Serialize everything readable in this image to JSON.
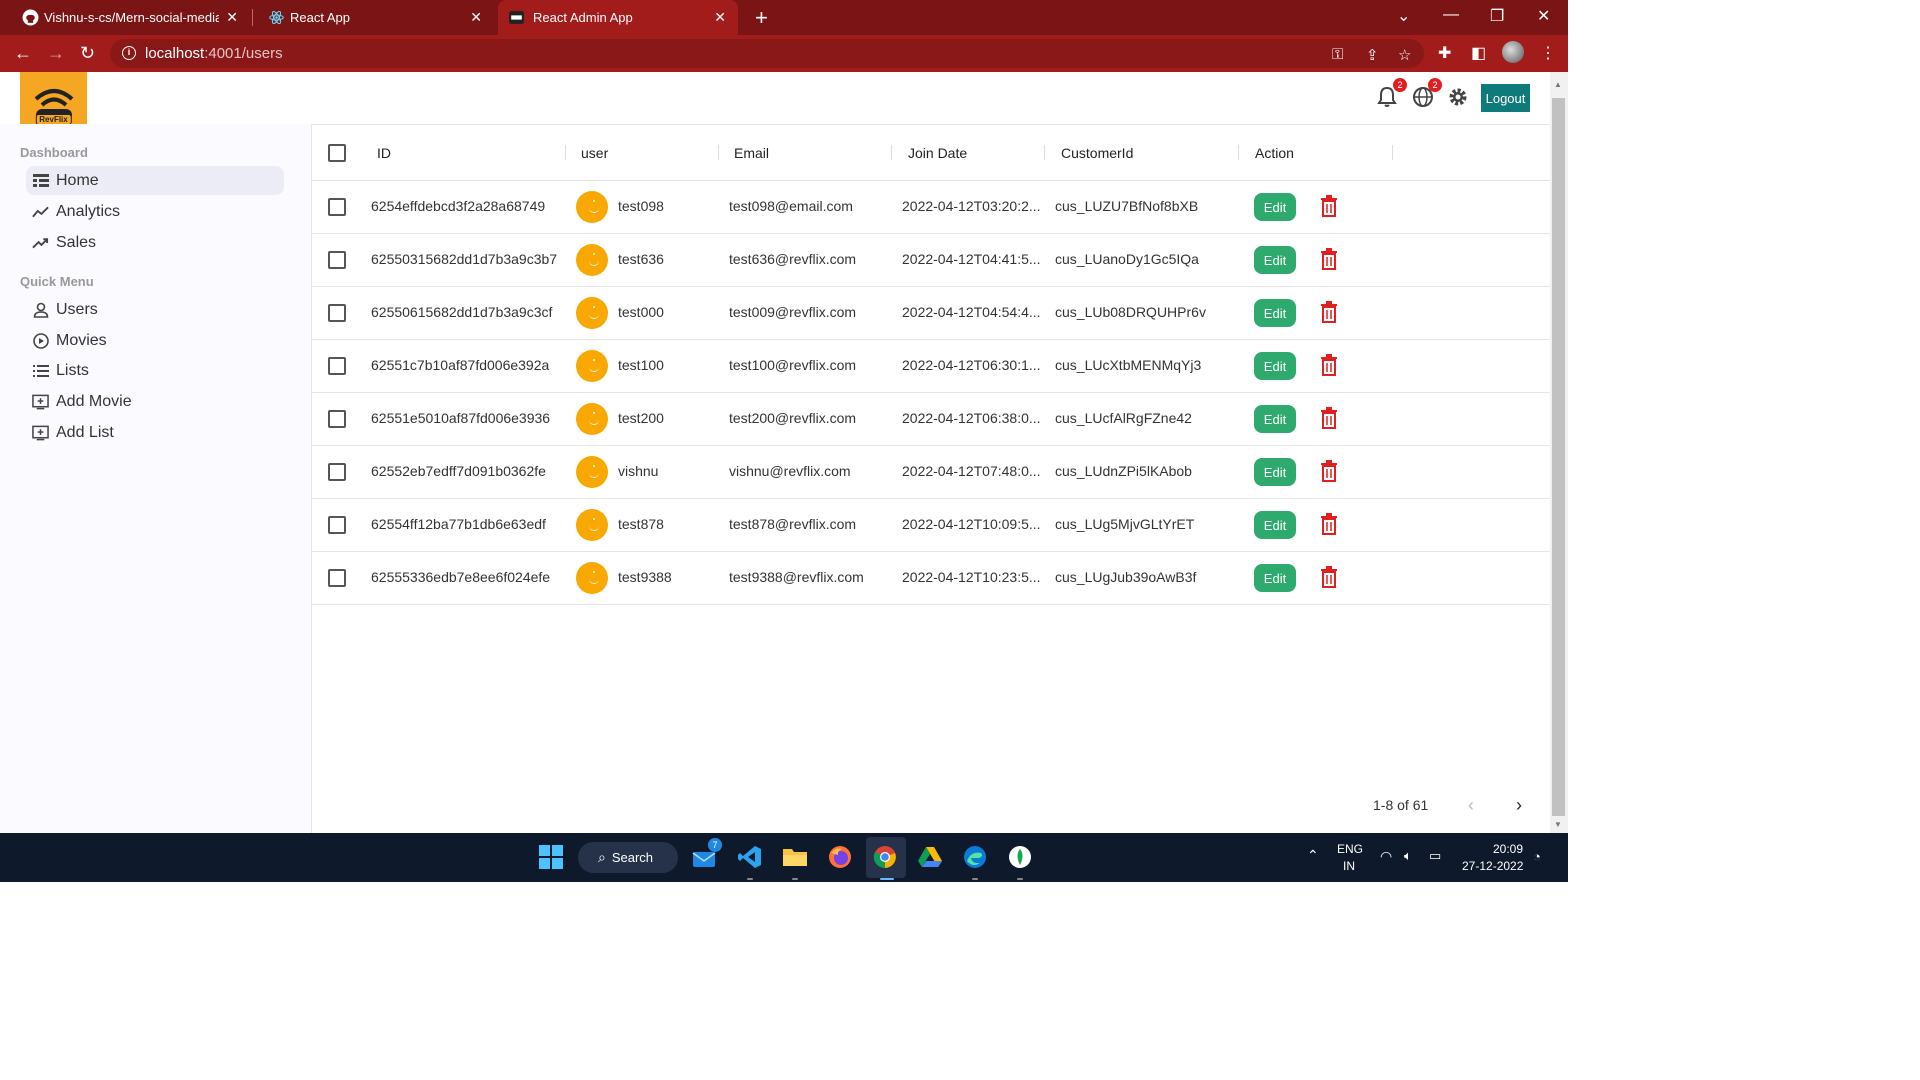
{
  "browser": {
    "tabs": [
      {
        "title": "Vishnu-s-cs/Mern-social-media-a",
        "icon": "github-icon",
        "active": false
      },
      {
        "title": "React App",
        "icon": "react-icon",
        "active": false
      },
      {
        "title": "React Admin App",
        "icon": "app-favicon-icon",
        "active": true
      }
    ],
    "new_tab_symbol": "+",
    "url_host": "localhost",
    "url_path": ":4001/users",
    "colors": {
      "chrome_dark": "#7b1414",
      "chrome": "#a31c1c"
    }
  },
  "topbar": {
    "logo_text": "RevFlix",
    "notifications_count": "2",
    "language_count": "2",
    "logout_label": "Logout",
    "logout_color": "#0e7a7a"
  },
  "sidebar": {
    "sections": [
      {
        "title": "Dashboard",
        "items": [
          {
            "label": "Home",
            "icon": "home-icon",
            "active": true
          },
          {
            "label": "Analytics",
            "icon": "analytics-icon",
            "active": false
          },
          {
            "label": "Sales",
            "icon": "trending-up-icon",
            "active": false
          }
        ]
      },
      {
        "title": "Quick Menu",
        "items": [
          {
            "label": "Users",
            "icon": "user-icon",
            "active": false
          },
          {
            "label": "Movies",
            "icon": "play-circle-icon",
            "active": false
          },
          {
            "label": "Lists",
            "icon": "list-icon",
            "active": false
          },
          {
            "label": "Add Movie",
            "icon": "add-box-icon",
            "active": false
          },
          {
            "label": "Add List",
            "icon": "add-box-icon",
            "active": false
          }
        ]
      }
    ]
  },
  "grid": {
    "columns": [
      "ID",
      "user",
      "Email",
      "Join Date",
      "CustomerId",
      "Action"
    ],
    "edit_label": "Edit",
    "edit_color": "#2eaa6e",
    "delete_color": "#e02020",
    "rows": [
      {
        "id": "6254effdebcd3f2a28a68749",
        "user": "test098",
        "email": "test098@email.com",
        "join_date": "2022-04-12T03:20:2...",
        "customer_id": "cus_LUZU7BfNof8bXB"
      },
      {
        "id": "62550315682dd1d7b3a9c3b7",
        "user": "test636",
        "email": "test636@revflix.com",
        "join_date": "2022-04-12T04:41:5...",
        "customer_id": "cus_LUanoDy1Gc5IQa"
      },
      {
        "id": "62550615682dd1d7b3a9c3cf",
        "user": "test000",
        "email": "test009@revflix.com",
        "join_date": "2022-04-12T04:54:4...",
        "customer_id": "cus_LUb08DRQUHPr6v"
      },
      {
        "id": "62551c7b10af87fd006e392a",
        "user": "test100",
        "email": "test100@revflix.com",
        "join_date": "2022-04-12T06:30:1...",
        "customer_id": "cus_LUcXtbMENMqYj3"
      },
      {
        "id": "62551e5010af87fd006e3936",
        "user": "test200",
        "email": "test200@revflix.com",
        "join_date": "2022-04-12T06:38:0...",
        "customer_id": "cus_LUcfAlRgFZne42"
      },
      {
        "id": "62552eb7edff7d091b0362fe",
        "user": "vishnu",
        "email": "vishnu@revflix.com",
        "join_date": "2022-04-12T07:48:0...",
        "customer_id": "cus_LUdnZPi5lKAbob"
      },
      {
        "id": "62554ff12ba77b1db6e63edf",
        "user": "test878",
        "email": "test878@revflix.com",
        "join_date": "2022-04-12T10:09:5...",
        "customer_id": "cus_LUg5MjvGLtYrET"
      },
      {
        "id": "62555336edb7e8ee6f024efe",
        "user": "test9388",
        "email": "test9388@revflix.com",
        "join_date": "2022-04-12T10:23:5...",
        "customer_id": "cus_LUgJub39oAwB3f"
      }
    ],
    "pagination": "1-8 of 61"
  },
  "taskbar": {
    "search_label": "Search",
    "mail_badge": "7",
    "language": "ENG",
    "region": "IN",
    "time": "20:09",
    "date": "27-12-2022"
  }
}
